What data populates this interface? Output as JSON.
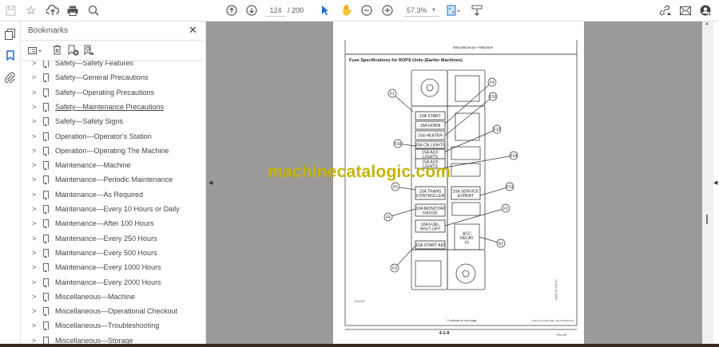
{
  "toolbar": {
    "icons": [
      "save-icon",
      "bookmark-star-icon",
      "upload-cloud-icon",
      "print-icon",
      "search-zoom-icon",
      "prev-page-icon",
      "next-page-icon",
      "select-cursor-icon",
      "hand-icon",
      "zoom-out-icon",
      "zoom-in-icon",
      "fit-page-icon",
      "scroll-mode-icon",
      "share-link-icon",
      "email-icon",
      "account-icon"
    ],
    "page_current": "124",
    "page_total": "/ 200",
    "zoom": "57.3%"
  },
  "panel": {
    "title": "Bookmarks",
    "bookmarks": [
      "Safety—Safety Features",
      "Safety—General Precautions",
      "Safety—Operating Precautions",
      "Safety—Maintenance Precautions",
      "Safety—Safety Signs",
      "Operation—Operator's Station",
      "Operation—Operating The Machine",
      "Maintenance—Machine",
      "Maintenance—Periodic Maintenance",
      "Maintenance—As Required",
      "Maintenance—Every 10 Hours or Daily",
      "Maintenance—After 100 Hours",
      "Maintenance—Every 250 Hours",
      "Maintenance—Every 500 Hours",
      "Maintenance—Every 1000 Hours",
      "Maintenance—Every 2000 Hours",
      "Miscellaneous—Machine",
      "Miscellaneous—Operational Checkout",
      "Miscellaneous—Troubleshooting",
      "Miscellaneous—Storage"
    ]
  },
  "document": {
    "header": "Miscellaneous—Machine",
    "section_title": "Fuse Specifications for ROPS Units (Earlier Machines)",
    "fuses": {
      "start": "10A START",
      "horn": "10A HORN",
      "heater": "15A HEATER",
      "cb_lights": "20A CB LIGHTS",
      "aux1": "15A AUX",
      "aux1b": "LIGHTS",
      "aux2": "15A AUX",
      "aux2b": "LIGHTS",
      "trans": "10A TRANS",
      "trans_b": "CONTROLLER",
      "service": "10A SERVICE",
      "service_b": "EXPERT",
      "monitor": "10A MONITOR/",
      "monitor_b": "GAUGE",
      "fuel": "10A FUEL",
      "fuel_b": "SHUT-OFF",
      "start_aid": "15A START AID",
      "relay": "ACC",
      "relay_b": "RELAY",
      "relay_c": "#1"
    },
    "callouts": [
      "F1",
      "F4",
      "F15",
      "F12",
      "F10",
      "F14",
      "F5",
      "F13",
      "F6",
      "F2",
      "K2",
      "F3"
    ],
    "figure_id": "TX10197",
    "side_code": "TX,4110,JC,00054",
    "continued": "Continued on next page",
    "footer_code": "CED,OUO1036,1985 -19-24APR96-2/3",
    "page_number": "4-1-8",
    "page_ref": "PN=124"
  },
  "watermark": "machinecatalogic.com"
}
